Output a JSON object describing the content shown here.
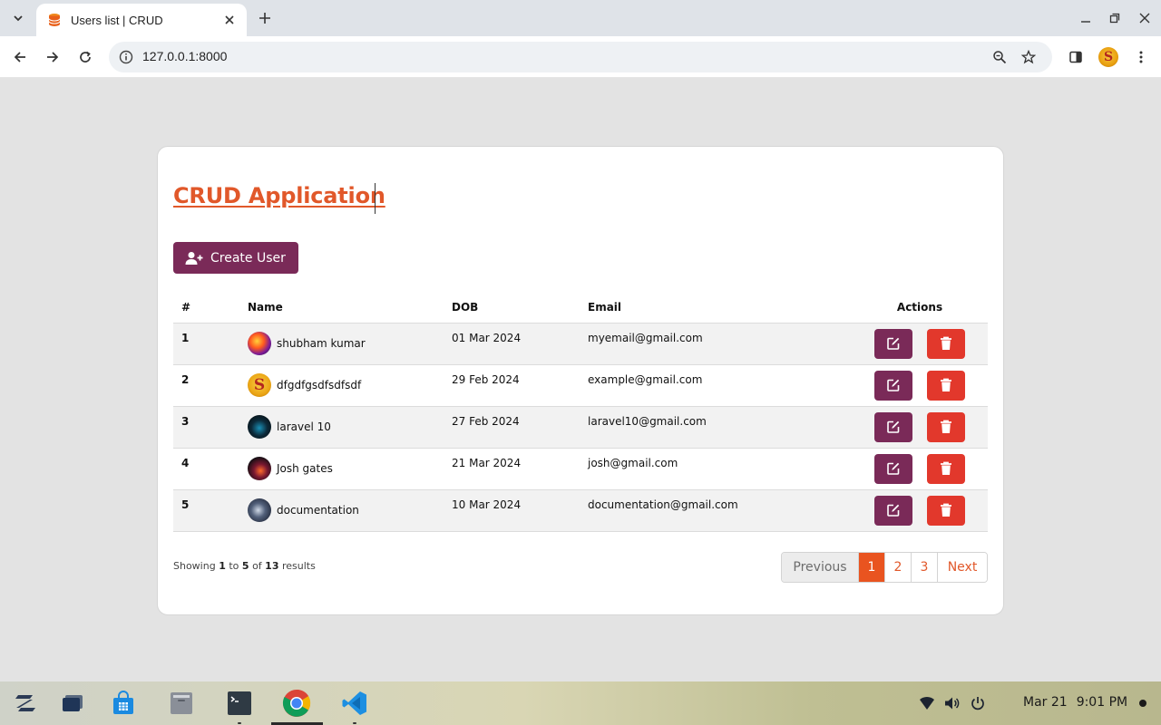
{
  "browser": {
    "tab_title": "Users list | CRUD",
    "url": "127.0.0.1:8000",
    "profile_initial": "S"
  },
  "page": {
    "title": "CRUD Application",
    "create_button_label": "Create User",
    "columns": [
      "#",
      "Name",
      "DOB",
      "Email",
      "Actions"
    ],
    "users": [
      {
        "num": "1",
        "name": "shubham kumar",
        "dob": "01 Mar 2024",
        "email": "myemail@gmail.com"
      },
      {
        "num": "2",
        "name": "dfgdfgsdfsdfsdf",
        "dob": "29 Feb 2024",
        "email": "example@gmail.com",
        "avatar_letter": "S"
      },
      {
        "num": "3",
        "name": "laravel 10",
        "dob": "27 Feb 2024",
        "email": "laravel10@gmail.com"
      },
      {
        "num": "4",
        "name": "Josh gates",
        "dob": "21 Mar 2024",
        "email": "josh@gmail.com"
      },
      {
        "num": "5",
        "name": "documentation",
        "dob": "10 Mar 2024",
        "email": "documentation@gmail.com"
      }
    ],
    "pagination_info": {
      "prefix": "Showing",
      "from": "1",
      "to_word": "to",
      "to": "5",
      "of_word": "of",
      "total": "13",
      "suffix": "results"
    },
    "pagination": {
      "previous": "Previous",
      "pages": [
        "1",
        "2",
        "3"
      ],
      "current": "1",
      "next": "Next"
    }
  },
  "taskbar": {
    "date": "Mar 21",
    "time": "9:01 PM"
  },
  "colors": {
    "accent_orange": "#e1582a",
    "active_page": "#e95420",
    "primary_purple": "#7a2a58",
    "danger_red": "#e2382c"
  },
  "icons": {
    "edit": "edit-icon",
    "delete": "trash-icon",
    "create": "user-plus-icon"
  }
}
